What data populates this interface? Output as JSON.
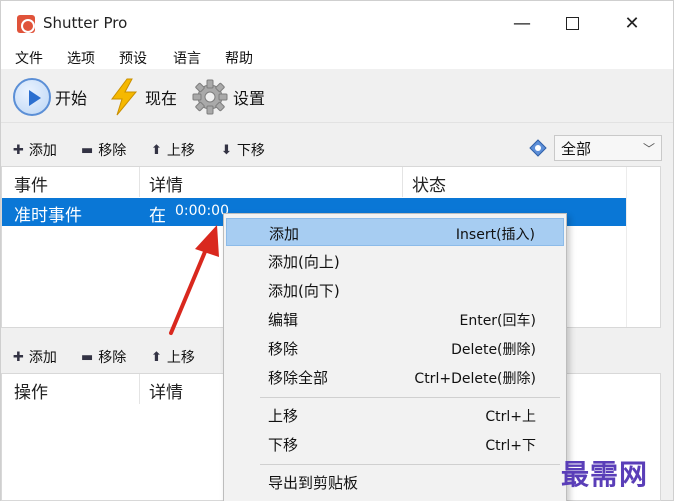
{
  "window": {
    "title": "Shutter Pro"
  },
  "menubar": {
    "items": [
      "文件",
      "选项",
      "预设",
      "语言",
      "帮助"
    ]
  },
  "toolbar": {
    "start_label": "开始",
    "now_label": "现在",
    "settings_label": "设置"
  },
  "events_bar": {
    "add_label": "添加",
    "remove_label": "移除",
    "up_label": "上移",
    "down_label": "下移",
    "filter_value": "全部"
  },
  "events_table": {
    "headers": [
      "事件",
      "详情",
      "状态"
    ],
    "rows": [
      {
        "event": "准时事件",
        "detail_prefix": "在",
        "detail_time": "0:00:00",
        "status": ""
      }
    ]
  },
  "actions_bar": {
    "add_label": "添加",
    "remove_label": "移除",
    "up_label": "上移"
  },
  "actions_table": {
    "headers": [
      "操作",
      "详情"
    ]
  },
  "context_menu": {
    "items": [
      {
        "label": "添加",
        "shortcut": "Insert(插入)"
      },
      {
        "label": "添加(向上)",
        "shortcut": ""
      },
      {
        "label": "添加(向下)",
        "shortcut": ""
      },
      {
        "label": "编辑",
        "shortcut": "Enter(回车)"
      },
      {
        "label": "移除",
        "shortcut": "Delete(删除)"
      },
      {
        "label": "移除全部",
        "shortcut": "Ctrl+Delete(删除)"
      },
      {
        "label": "上移",
        "shortcut": "Ctrl+上"
      },
      {
        "label": "下移",
        "shortcut": "Ctrl+下"
      },
      {
        "label": "导出到剪贴板",
        "shortcut": ""
      }
    ]
  },
  "watermark": "最需网",
  "colors": {
    "selection": "#0a77d6",
    "menu_highlight": "#a7cdf2",
    "arrow": "#d9281e",
    "watermark": "#5a3eb8"
  },
  "icons": [
    "app-icon",
    "play-icon",
    "lightning-icon",
    "gear-icon",
    "plus-icon",
    "minus-icon",
    "arrow-up-icon",
    "arrow-down-icon",
    "filter-icon"
  ]
}
